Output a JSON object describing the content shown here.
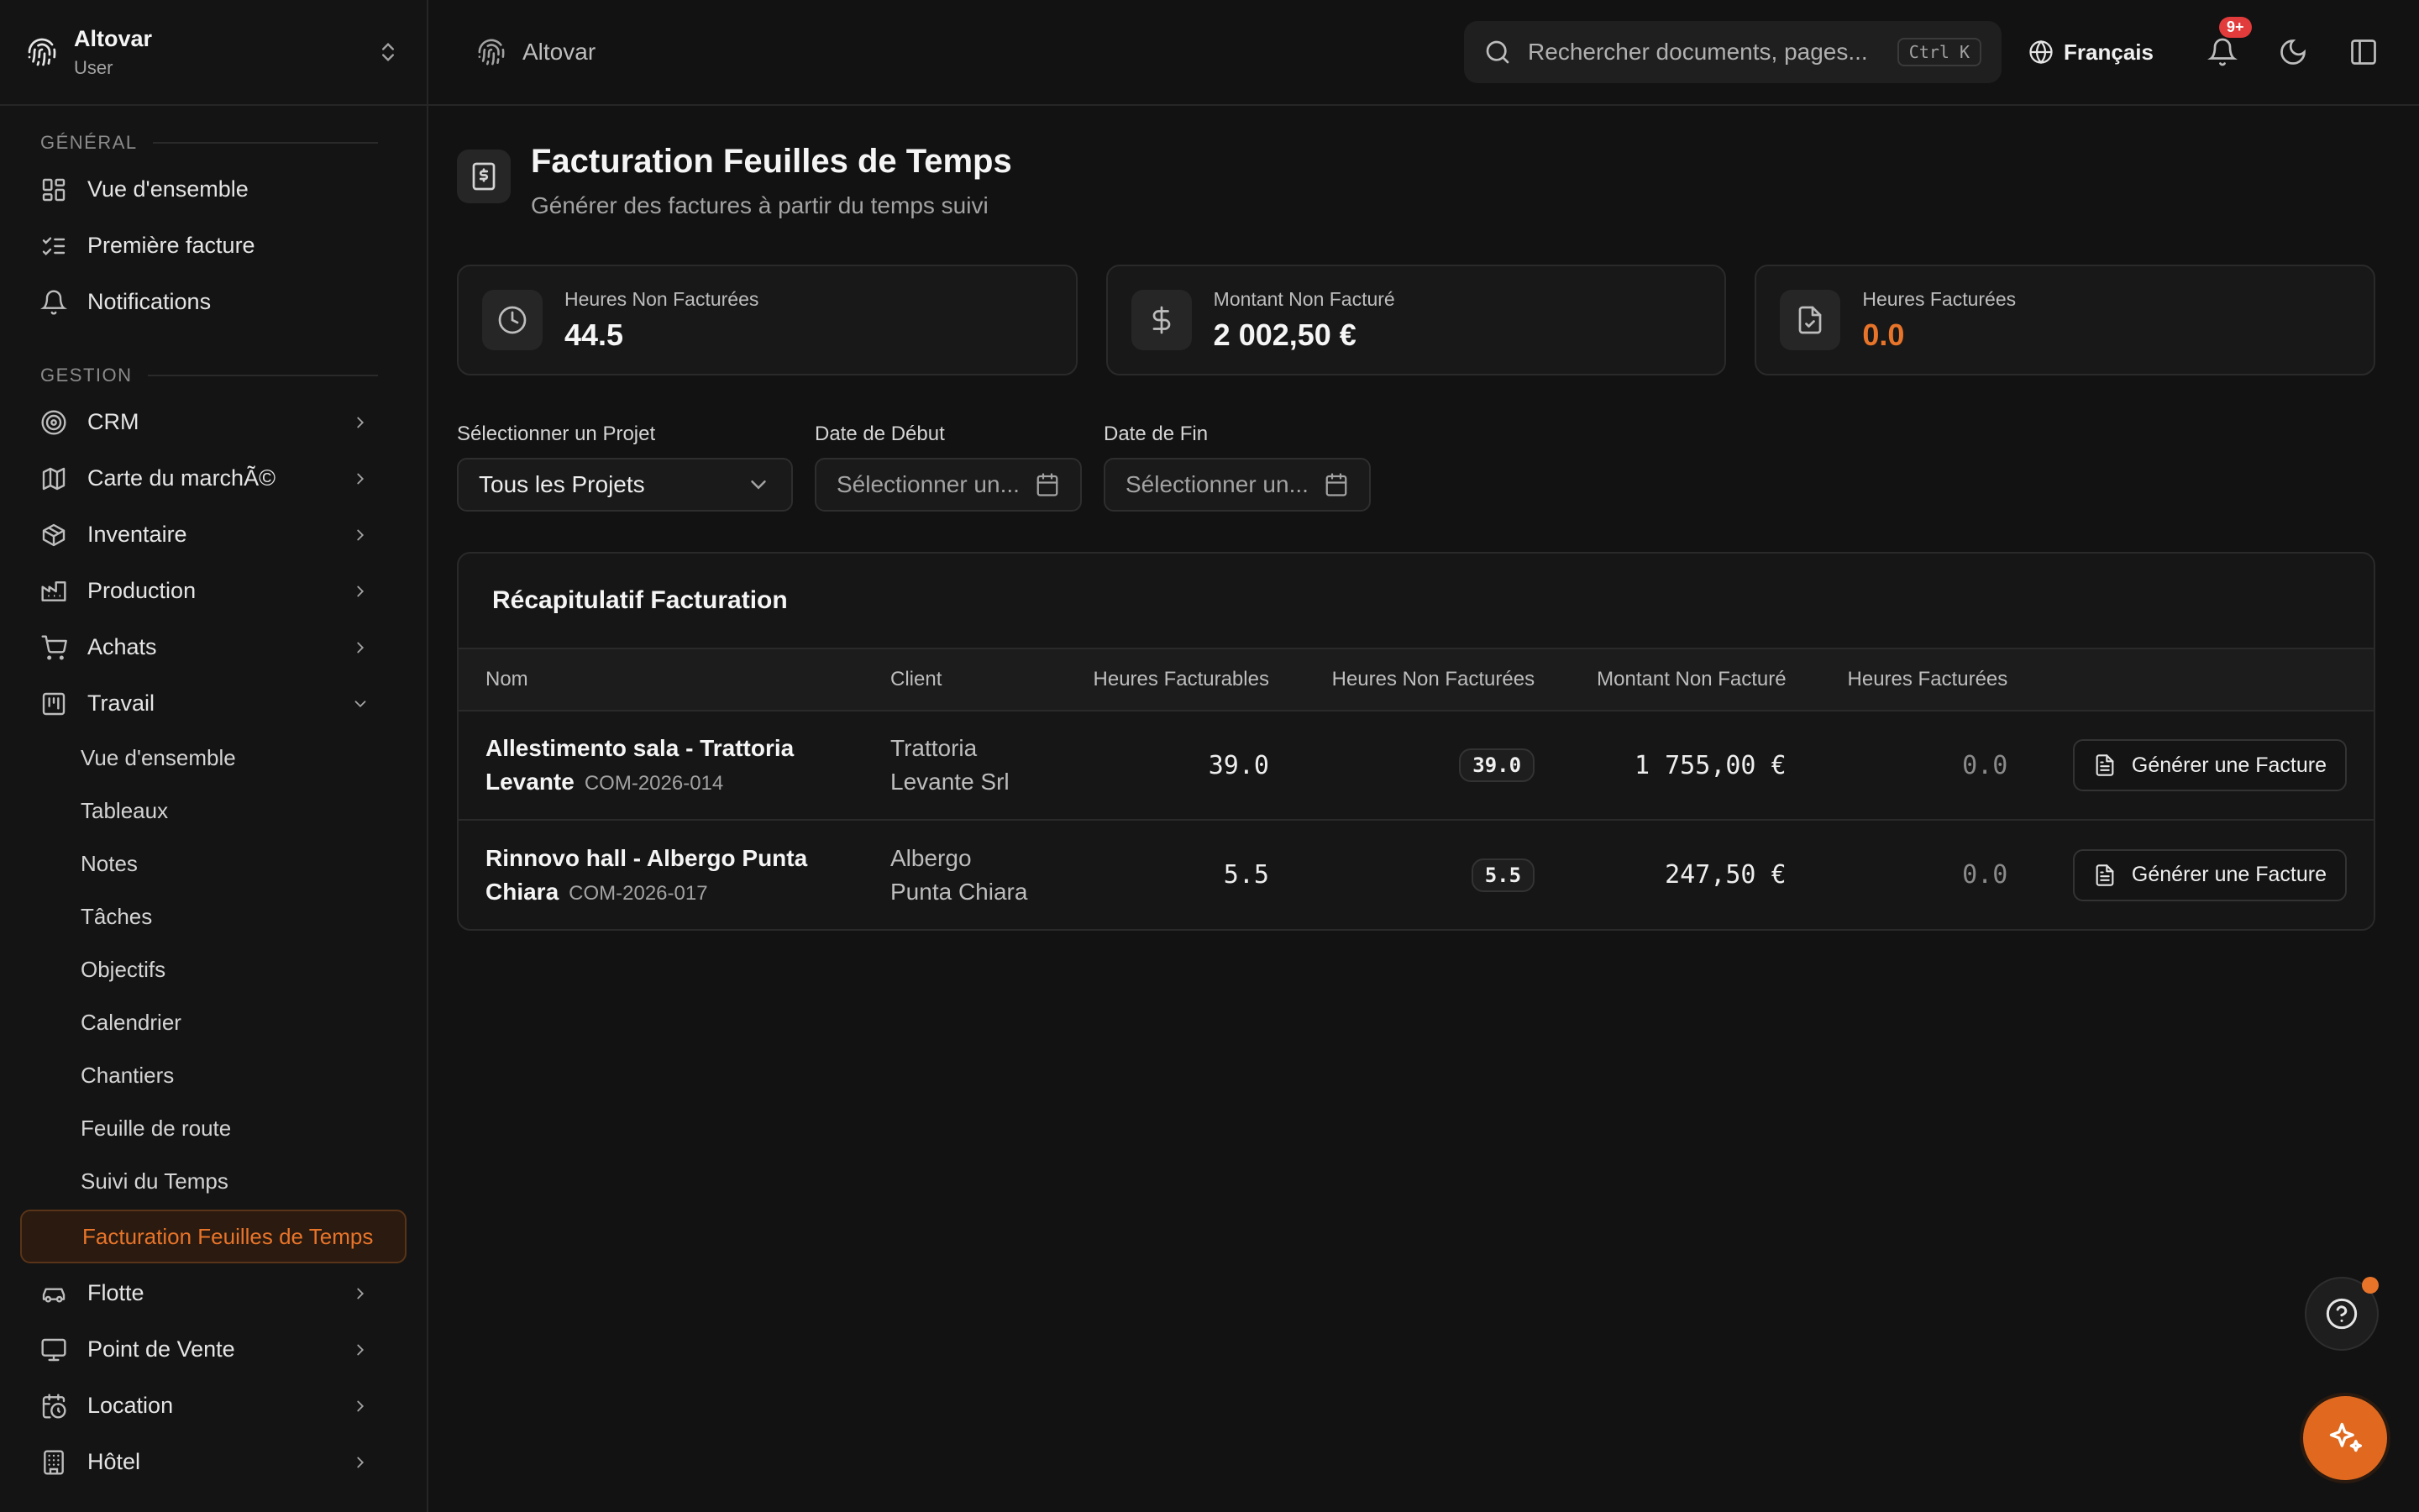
{
  "app": {
    "org_name": "Altovar",
    "org_role": "User"
  },
  "sidebar": {
    "sections": {
      "general": "GÉNÉRAL",
      "gestion": "GESTION"
    },
    "general_items": [
      {
        "label": "Vue d'ensemble",
        "icon": "layout-dashboard-icon"
      },
      {
        "label": "Première facture",
        "icon": "list-checks-icon"
      },
      {
        "label": "Notifications",
        "icon": "bell-icon"
      }
    ],
    "gestion_items": [
      {
        "label": "CRM",
        "icon": "target-icon"
      },
      {
        "label": "Carte du marchÃ©",
        "icon": "map-icon"
      },
      {
        "label": "Inventaire",
        "icon": "package-icon"
      },
      {
        "label": "Production",
        "icon": "factory-icon"
      },
      {
        "label": "Achats",
        "icon": "cart-icon"
      },
      {
        "label": "Travail",
        "icon": "kanban-icon",
        "expanded": true
      }
    ],
    "travail_sub": [
      "Vue d'ensemble",
      "Tableaux",
      "Notes",
      "Tâches",
      "Objectifs",
      "Calendrier",
      "Chantiers",
      "Feuille de route",
      "Suivi du Temps",
      "Facturation Feuilles de Temps"
    ],
    "more_items": [
      {
        "label": "Flotte",
        "icon": "car-icon"
      },
      {
        "label": "Point de Vente",
        "icon": "monitor-icon"
      },
      {
        "label": "Location",
        "icon": "calendar-clock-icon"
      },
      {
        "label": "Hôtel",
        "icon": "hotel-icon"
      }
    ]
  },
  "topbar": {
    "breadcrumb": "Altovar",
    "search_placeholder": "Rechercher documents, pages...",
    "search_shortcut": "Ctrl K",
    "language": "Français",
    "notification_count": "9+"
  },
  "page": {
    "title": "Facturation Feuilles de Temps",
    "subtitle": "Générer des factures à partir du temps suivi"
  },
  "stats": [
    {
      "label": "Heures Non Facturées",
      "value": "44.5",
      "icon": "clock-icon"
    },
    {
      "label": "Montant Non Facturé",
      "value": "2 002,50 €",
      "icon": "dollar-icon"
    },
    {
      "label": "Heures Facturées",
      "value": "0.0",
      "icon": "file-check-icon",
      "accent": "#e8742a"
    }
  ],
  "filters": {
    "project_label": "Sélectionner un Projet",
    "project_value": "Tous les Projets",
    "start_label": "Date de Début",
    "start_placeholder": "Sélectionner un...",
    "end_label": "Date de Fin",
    "end_placeholder": "Sélectionner un..."
  },
  "summary": {
    "title": "Récapitulatif Facturation",
    "columns": [
      "Nom",
      "Client",
      "Heures Facturables",
      "Heures Non Facturées",
      "Montant Non Facturé",
      "Heures Facturées"
    ],
    "rows": [
      {
        "name": "Allestimento sala - Trattoria Levante",
        "code": "COM-2026-014",
        "client": "Trattoria Levante Srl",
        "billable_hours": "39.0",
        "unbilled_hours": "39.0",
        "unbilled_amount": "1 755,00 €",
        "billed_hours": "0.0",
        "action": "Générer une Facture"
      },
      {
        "name": "Rinnovo hall - Albergo Punta Chiara",
        "code": "COM-2026-017",
        "client": "Albergo Punta Chiara",
        "billable_hours": "5.5",
        "unbilled_hours": "5.5",
        "unbilled_amount": "247,50 €",
        "billed_hours": "0.0",
        "action": "Générer une Facture"
      }
    ]
  },
  "colors": {
    "accent": "#e8742a",
    "background": "#121212",
    "badge": "#e23b3b"
  }
}
